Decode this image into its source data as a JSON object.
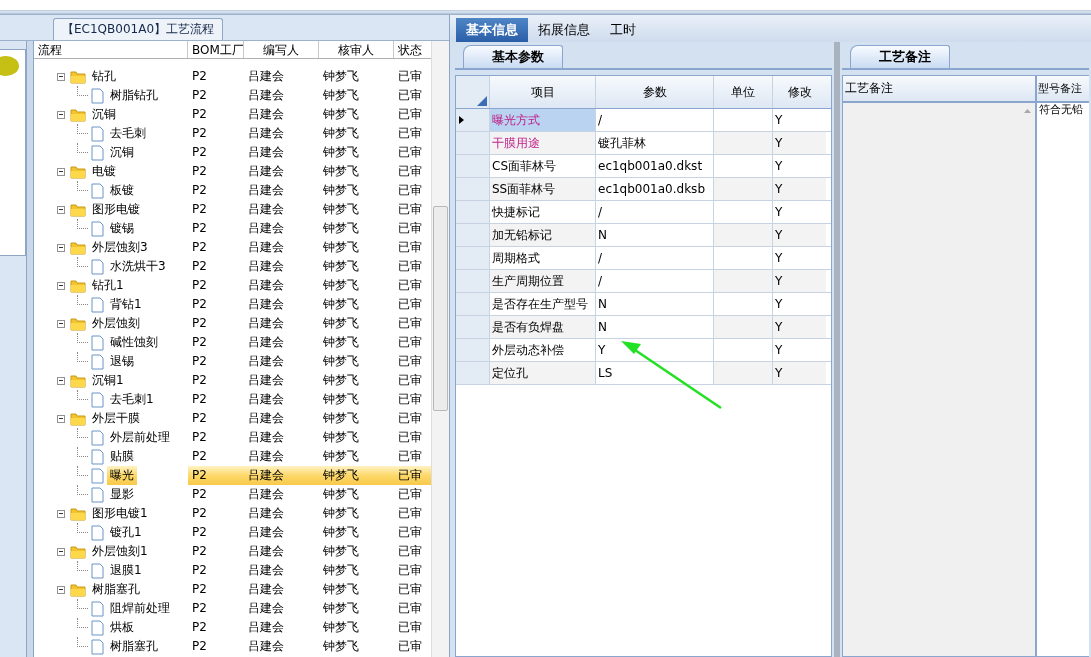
{
  "flow_panel": {
    "title": "【EC1QB001A0】工艺流程",
    "columns": [
      "流程",
      "BOM工厂",
      "编写人",
      "核审人",
      "状态"
    ],
    "tree": [
      {
        "label": "钻孔",
        "bom": "P2",
        "author": "吕建会",
        "reviewer": "钟梦飞",
        "status": "已审",
        "expanded": true,
        "selected": false,
        "children": [
          {
            "label": "树脂钻孔",
            "bom": "P2",
            "author": "吕建会",
            "reviewer": "钟梦飞",
            "status": "已审",
            "selected": false
          }
        ]
      },
      {
        "label": "沉铜",
        "bom": "P2",
        "author": "吕建会",
        "reviewer": "钟梦飞",
        "status": "已审",
        "expanded": true,
        "selected": false,
        "children": [
          {
            "label": "去毛刺",
            "bom": "P2",
            "author": "吕建会",
            "reviewer": "钟梦飞",
            "status": "已审",
            "selected": false
          },
          {
            "label": "沉铜",
            "bom": "P2",
            "author": "吕建会",
            "reviewer": "钟梦飞",
            "status": "已审",
            "selected": false
          }
        ]
      },
      {
        "label": "电镀",
        "bom": "P2",
        "author": "吕建会",
        "reviewer": "钟梦飞",
        "status": "已审",
        "expanded": true,
        "selected": false,
        "children": [
          {
            "label": "板镀",
            "bom": "P2",
            "author": "吕建会",
            "reviewer": "钟梦飞",
            "status": "已审",
            "selected": false
          }
        ]
      },
      {
        "label": "图形电镀",
        "bom": "P2",
        "author": "吕建会",
        "reviewer": "钟梦飞",
        "status": "已审",
        "expanded": true,
        "selected": false,
        "children": [
          {
            "label": "镀锡",
            "bom": "P2",
            "author": "吕建会",
            "reviewer": "钟梦飞",
            "status": "已审",
            "selected": false
          }
        ]
      },
      {
        "label": "外层蚀刻3",
        "bom": "P2",
        "author": "吕建会",
        "reviewer": "钟梦飞",
        "status": "已审",
        "expanded": true,
        "selected": false,
        "children": [
          {
            "label": "水洗烘干3",
            "bom": "P2",
            "author": "吕建会",
            "reviewer": "钟梦飞",
            "status": "已审",
            "selected": false
          }
        ]
      },
      {
        "label": "钻孔1",
        "bom": "P2",
        "author": "吕建会",
        "reviewer": "钟梦飞",
        "status": "已审",
        "expanded": true,
        "selected": false,
        "children": [
          {
            "label": "背钻1",
            "bom": "P2",
            "author": "吕建会",
            "reviewer": "钟梦飞",
            "status": "已审",
            "selected": false
          }
        ]
      },
      {
        "label": "外层蚀刻",
        "bom": "P2",
        "author": "吕建会",
        "reviewer": "钟梦飞",
        "status": "已审",
        "expanded": true,
        "selected": false,
        "children": [
          {
            "label": "碱性蚀刻",
            "bom": "P2",
            "author": "吕建会",
            "reviewer": "钟梦飞",
            "status": "已审",
            "selected": false
          },
          {
            "label": "退锡",
            "bom": "P2",
            "author": "吕建会",
            "reviewer": "钟梦飞",
            "status": "已审",
            "selected": false
          }
        ]
      },
      {
        "label": "沉铜1",
        "bom": "P2",
        "author": "吕建会",
        "reviewer": "钟梦飞",
        "status": "已审",
        "expanded": true,
        "selected": false,
        "children": [
          {
            "label": "去毛刺1",
            "bom": "P2",
            "author": "吕建会",
            "reviewer": "钟梦飞",
            "status": "已审",
            "selected": false
          }
        ]
      },
      {
        "label": "外层干膜",
        "bom": "P2",
        "author": "吕建会",
        "reviewer": "钟梦飞",
        "status": "已审",
        "expanded": true,
        "selected": false,
        "children": [
          {
            "label": "外层前处理",
            "bom": "P2",
            "author": "吕建会",
            "reviewer": "钟梦飞",
            "status": "已审",
            "selected": false
          },
          {
            "label": "贴膜",
            "bom": "P2",
            "author": "吕建会",
            "reviewer": "钟梦飞",
            "status": "已审",
            "selected": false
          },
          {
            "label": "曝光",
            "bom": "P2",
            "author": "吕建会",
            "reviewer": "钟梦飞",
            "status": "已审",
            "selected": true
          },
          {
            "label": "显影",
            "bom": "P2",
            "author": "吕建会",
            "reviewer": "钟梦飞",
            "status": "已审",
            "selected": false
          }
        ]
      },
      {
        "label": "图形电镀1",
        "bom": "P2",
        "author": "吕建会",
        "reviewer": "钟梦飞",
        "status": "已审",
        "expanded": true,
        "selected": false,
        "children": [
          {
            "label": "镀孔1",
            "bom": "P2",
            "author": "吕建会",
            "reviewer": "钟梦飞",
            "status": "已审",
            "selected": false
          }
        ]
      },
      {
        "label": "外层蚀刻1",
        "bom": "P2",
        "author": "吕建会",
        "reviewer": "钟梦飞",
        "status": "已审",
        "expanded": true,
        "selected": false,
        "children": [
          {
            "label": "退膜1",
            "bom": "P2",
            "author": "吕建会",
            "reviewer": "钟梦飞",
            "status": "已审",
            "selected": false
          }
        ]
      },
      {
        "label": "树脂塞孔",
        "bom": "P2",
        "author": "吕建会",
        "reviewer": "钟梦飞",
        "status": "已审",
        "expanded": true,
        "selected": false,
        "children": [
          {
            "label": "阻焊前处理",
            "bom": "P2",
            "author": "吕建会",
            "reviewer": "钟梦飞",
            "status": "已审",
            "selected": false
          },
          {
            "label": "烘板",
            "bom": "P2",
            "author": "吕建会",
            "reviewer": "钟梦飞",
            "status": "已审",
            "selected": false
          },
          {
            "label": "树脂塞孔",
            "bom": "P2",
            "author": "吕建会",
            "reviewer": "钟梦飞",
            "status": "已审",
            "selected": false
          }
        ]
      }
    ]
  },
  "tabs": [
    {
      "label": "基本信息",
      "selected": true
    },
    {
      "label": "拓展信息",
      "selected": false
    },
    {
      "label": "工时",
      "selected": false
    }
  ],
  "params_panel": {
    "tab": "基本参数",
    "columns": [
      "项目",
      "参数",
      "单位",
      "修改"
    ],
    "rows": [
      {
        "item": "曝光方式",
        "value": "/",
        "modify": "Y",
        "emphasized": true,
        "selected": true
      },
      {
        "item": "干膜用途",
        "value": "镀孔菲林",
        "modify": "Y",
        "emphasized": true,
        "selected": false
      },
      {
        "item": "CS面菲林号",
        "value": "ec1qb001a0.dkst",
        "modify": "Y",
        "emphasized": false,
        "selected": false
      },
      {
        "item": "SS面菲林号",
        "value": "ec1qb001a0.dksb",
        "modify": "Y",
        "emphasized": false,
        "selected": false
      },
      {
        "item": "快捷标记",
        "value": "/",
        "modify": "Y",
        "emphasized": false,
        "selected": false
      },
      {
        "item": "加无铅标记",
        "value": "N",
        "modify": "Y",
        "emphasized": false,
        "selected": false
      },
      {
        "item": "周期格式",
        "value": "/",
        "modify": "Y",
        "emphasized": false,
        "selected": false
      },
      {
        "item": "生产周期位置",
        "value": "/",
        "modify": "Y",
        "emphasized": false,
        "selected": false
      },
      {
        "item": "是否存在生产型号",
        "value": "N",
        "modify": "Y",
        "emphasized": false,
        "selected": false
      },
      {
        "item": "是否有负焊盘",
        "value": "N",
        "modify": "Y",
        "emphasized": false,
        "selected": false
      },
      {
        "item": "外层动态补偿",
        "value": "Y",
        "modify": "Y",
        "emphasized": false,
        "selected": false
      },
      {
        "item": "定位孔",
        "value": "LS",
        "modify": "Y",
        "emphasized": false,
        "selected": false
      }
    ]
  },
  "notes_panel": {
    "tab": "工艺备注",
    "columns": [
      "工艺备注",
      "型号备注"
    ],
    "model_note": "符合无铅"
  }
}
